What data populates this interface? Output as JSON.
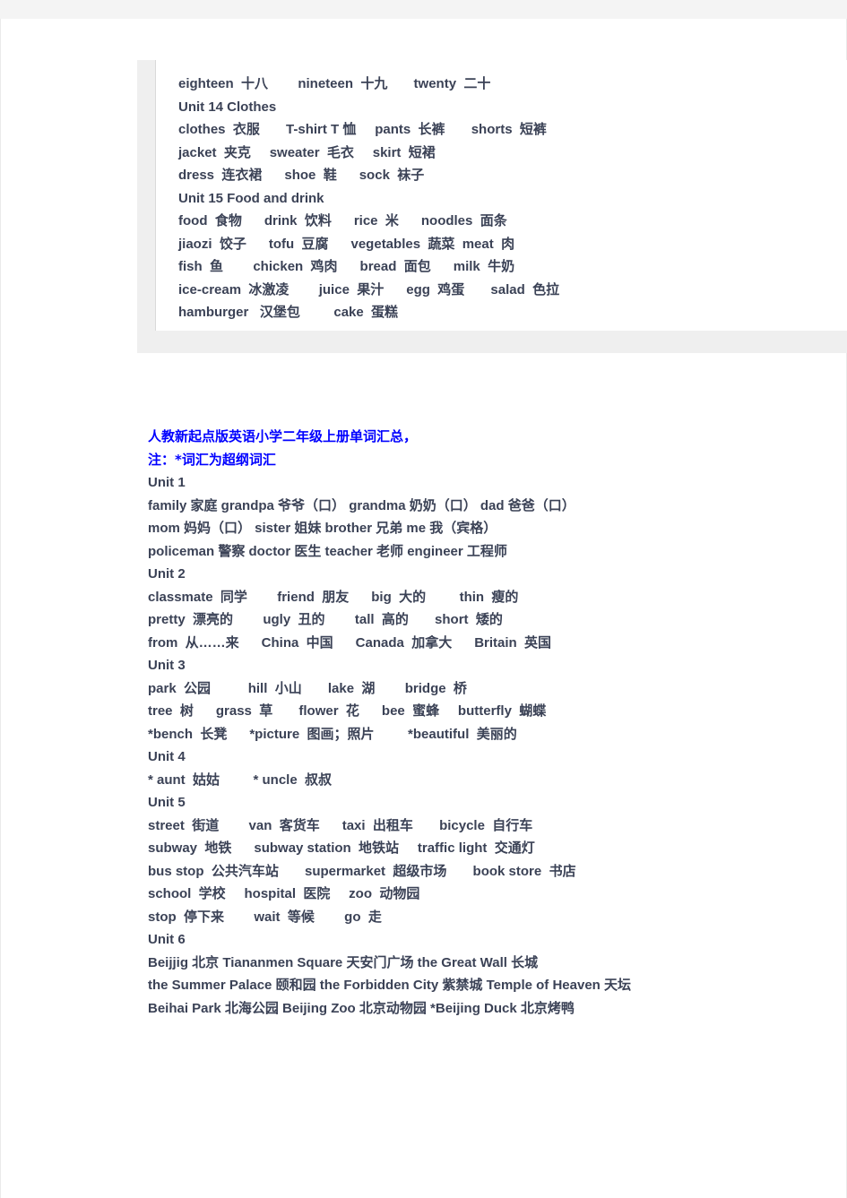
{
  "document": {
    "title_line_1": "人教新起点版英语小学二年级上册单词汇总，",
    "title_line_2": "注：*词汇为超纲词汇"
  },
  "top_excerpt": {
    "lines": [
      "eighteen  十八        nineteen  十九       twenty  二十",
      "Unit 14 Clothes",
      "clothes  衣服       T-shirt T 恤     pants  长裤       shorts  短裤",
      "jacket  夹克     sweater  毛衣     skirt  短裙",
      "dress  连衣裙      shoe  鞋      sock  袜子",
      "Unit 15 Food and drink",
      "food  食物      drink  饮料      rice  米      noodles  面条",
      "jiaozi  饺子      tofu  豆腐      vegetables  蔬菜  meat  肉",
      "fish  鱼        chicken  鸡肉      bread  面包      milk  牛奶",
      "ice-cream  冰激凌        juice  果汁      egg  鸡蛋       salad  色拉",
      "hamburger   汉堡包         cake  蛋糕"
    ]
  },
  "units": [
    {
      "heading": "Unit 1",
      "lines": [
        "family  家庭      grandpa  爷爷（口）      grandma  奶奶（口）         dad  爸爸（口）",
        "mom  妈妈（口）        sister  姐妹         brother  兄弟         me  我（宾格）",
        "policeman  警察        doctor  医生       teacher  老师           engineer  工程师"
      ]
    },
    {
      "heading": "Unit 2",
      "lines": [
        "classmate  同学        friend  朋友      big  大的         thin  瘦的",
        "pretty  漂亮的        ugly  丑的        tall  高的       short  矮的",
        "from  从……来      China  中国      Canada  加拿大      Britain  英国"
      ]
    },
    {
      "heading": "Unit 3",
      "lines": [
        "park  公园          hill  小山       lake  湖        bridge  桥",
        "tree  树      grass  草       flower  花      bee  蜜蜂     butterfly  蝴蝶",
        "*bench  长凳      *picture  图画；照片         *beautiful  美丽的"
      ]
    },
    {
      "heading": "Unit 4",
      "lines": [
        "* aunt  姑姑         * uncle  叔叔"
      ]
    },
    {
      "heading": "Unit 5",
      "lines": [
        "street  街道        van  客货车      taxi  出租车       bicycle  自行车",
        "subway  地铁      subway station  地铁站     traffic light  交通灯",
        "bus stop  公共汽车站       supermarket  超级市场       book store  书店",
        "school  学校     hospital  医院     zoo  动物园",
        "stop  停下来        wait  等候        go  走"
      ]
    },
    {
      "heading": "Unit 6",
      "lines": [
        "Beijjig  北京          Tiananmen Square  天安门广场        the Great Wall  长城",
        "the Summer Palace  颐和园       the Forbidden City  紫禁城        Temple of Heaven  天坛",
        "Beihai Park  北海公园        Beijing Zoo  北京动物园     *Beijing Duck  北京烤鸭"
      ]
    }
  ],
  "colors": {
    "title_blue": "#0000ff",
    "body_text": "#3b4256",
    "band_gray": "#efefef",
    "page_white": "#ffffff"
  }
}
